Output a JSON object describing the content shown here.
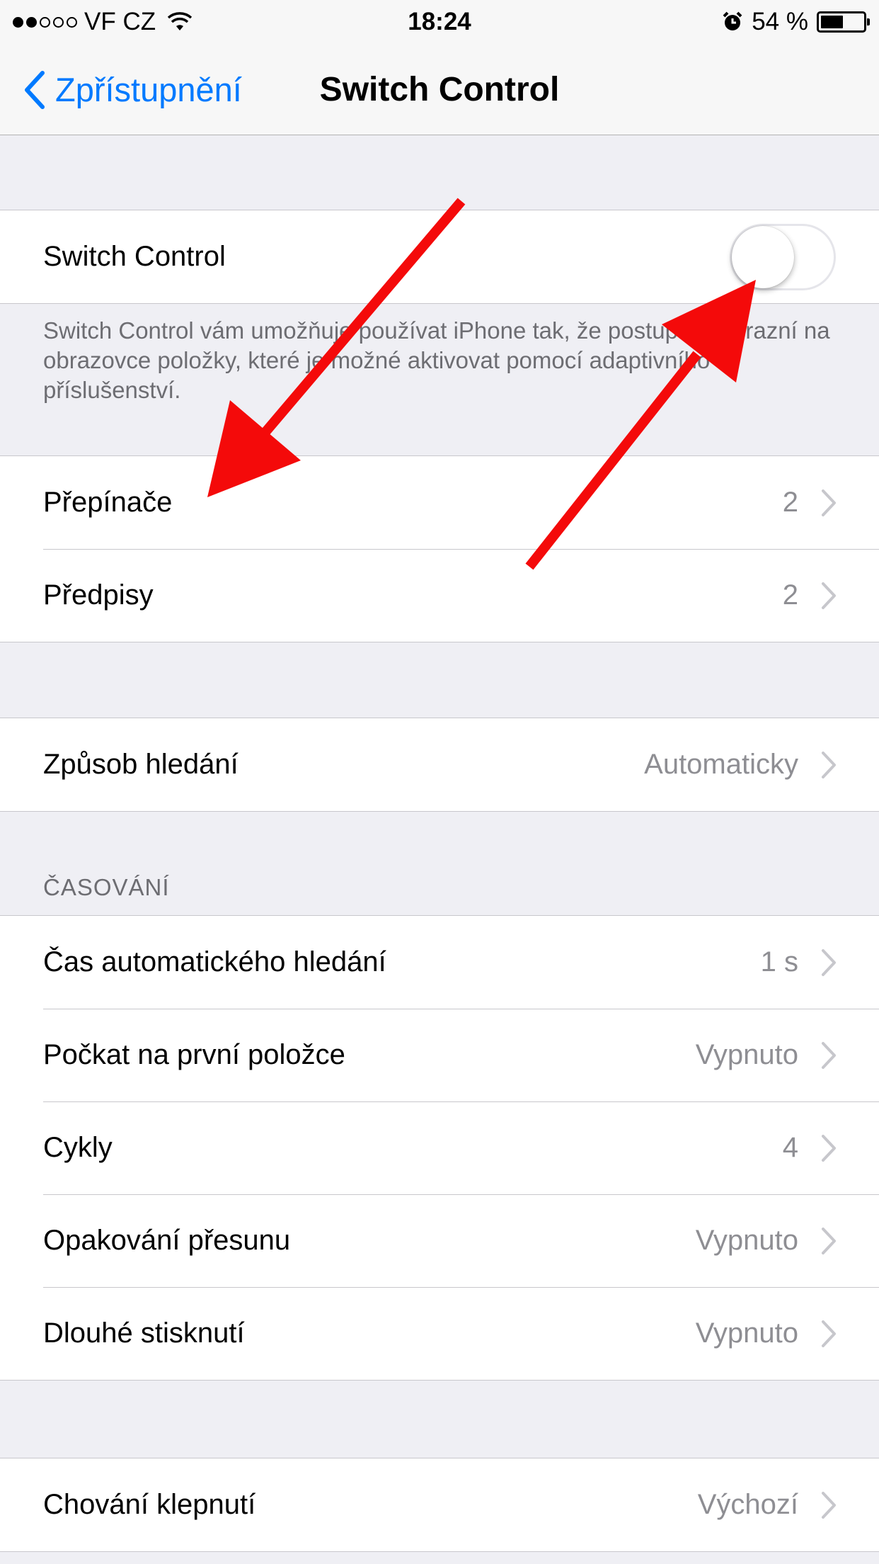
{
  "status_bar": {
    "carrier": "VF CZ",
    "time": "18:24",
    "battery_percent": "54 %",
    "battery_level": 0.54,
    "signal_bars_filled": 2,
    "signal_bars_total": 5
  },
  "nav": {
    "back_label": "Zpřístupnění",
    "title": "Switch Control"
  },
  "switch_group": {
    "label": "Switch Control",
    "toggle_on": false
  },
  "switch_footer": "Switch Control vám umožňuje používat iPhone tak, že postupně zvýrazní na obrazovce položky, které je možné aktivovat pomocí adaptivního příslušenství.",
  "group1": [
    {
      "label": "Přepínače",
      "value": "2"
    },
    {
      "label": "Předpisy",
      "value": "2"
    }
  ],
  "group2": [
    {
      "label": "Způsob hledání",
      "value": "Automaticky"
    }
  ],
  "timing_header": "ČASOVÁNÍ",
  "timing": [
    {
      "label": "Čas automatického hledání",
      "value": "1 s"
    },
    {
      "label": "Počkat na první položce",
      "value": "Vypnuto"
    },
    {
      "label": "Cykly",
      "value": "4"
    },
    {
      "label": "Opakování přesunu",
      "value": "Vypnuto"
    },
    {
      "label": "Dlouhé stisknutí",
      "value": "Vypnuto"
    }
  ],
  "group4": [
    {
      "label": "Chování klepnutí",
      "value": "Výchozí"
    }
  ],
  "colors": {
    "accent": "#007aff",
    "annotation_arrow": "#f40a0a",
    "secondary_text": "#8e8e93",
    "background": "#efeff4"
  }
}
